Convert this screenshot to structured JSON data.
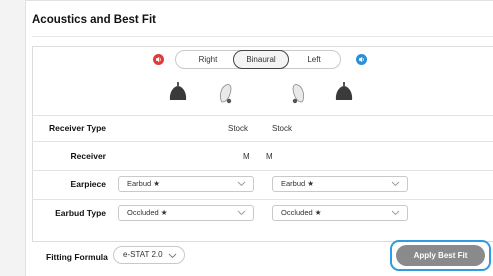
{
  "section": {
    "title": "Acoustics and Best Fit"
  },
  "side_selector": {
    "options": [
      "Right",
      "Binaural",
      "Left"
    ],
    "selected": "Binaural",
    "right_color": "#e03b3b",
    "left_color": "#2a8ed8"
  },
  "rows": {
    "receiver_type": {
      "label": "Receiver Type",
      "right": "Stock",
      "left": "Stock"
    },
    "receiver": {
      "label": "Receiver",
      "right": "M",
      "left": "M"
    },
    "earpiece": {
      "label": "Earpiece",
      "right": "Earbud ★",
      "left": "Earbud ★"
    },
    "earbud_type": {
      "label": "Earbud Type",
      "right": "Occluded ★",
      "left": "Occluded ★"
    }
  },
  "fitting_formula": {
    "label": "Fitting Formula",
    "value": "e-STAT 2.0"
  },
  "apply_button": {
    "label": "Apply Best Fit",
    "ring_color": "#2f9be0"
  }
}
